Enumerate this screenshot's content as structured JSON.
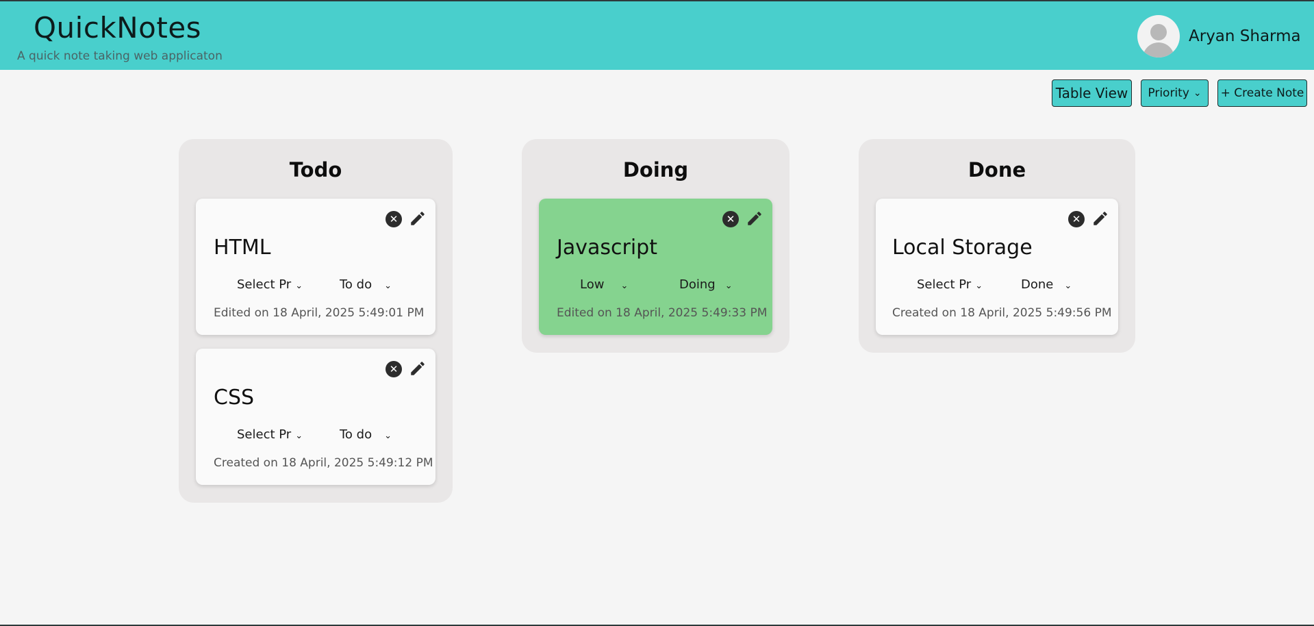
{
  "header": {
    "title": "QuickNotes",
    "subtitle": "A quick note taking web applicaton",
    "user_name": "Aryan Sharma"
  },
  "toolbar": {
    "table_view_label": "Table View",
    "priority_label": "Priority",
    "create_note_label": "+ Create Note"
  },
  "columns": [
    {
      "title": "Todo",
      "cards": [
        {
          "title": "HTML",
          "priority": "Select Pr",
          "status": "To do",
          "timestamp": "Edited on 18 April, 2025 5:49:01 PM"
        },
        {
          "title": "CSS",
          "priority": "Select Pr",
          "status": "To do",
          "timestamp": "Created on 18 April, 2025 5:49:12 PM"
        }
      ]
    },
    {
      "title": "Doing",
      "cards": [
        {
          "title": "Javascript",
          "priority": "Low",
          "status": "Doing",
          "timestamp": "Edited on 18 April, 2025 5:49:33 PM"
        }
      ]
    },
    {
      "title": "Done",
      "cards": [
        {
          "title": "Local Storage",
          "priority": "Select Pr",
          "status": "Done",
          "timestamp": "Created on 18 April, 2025 5:49:56 PM"
        }
      ]
    }
  ],
  "colors": {
    "header_bg": "#49cfcc",
    "low_priority_card": "#85d38f",
    "column_bg": "#e9e7e7"
  },
  "icons": {
    "close": "close-icon",
    "edit": "pencil-icon",
    "chevron": "chevron-down-icon"
  }
}
